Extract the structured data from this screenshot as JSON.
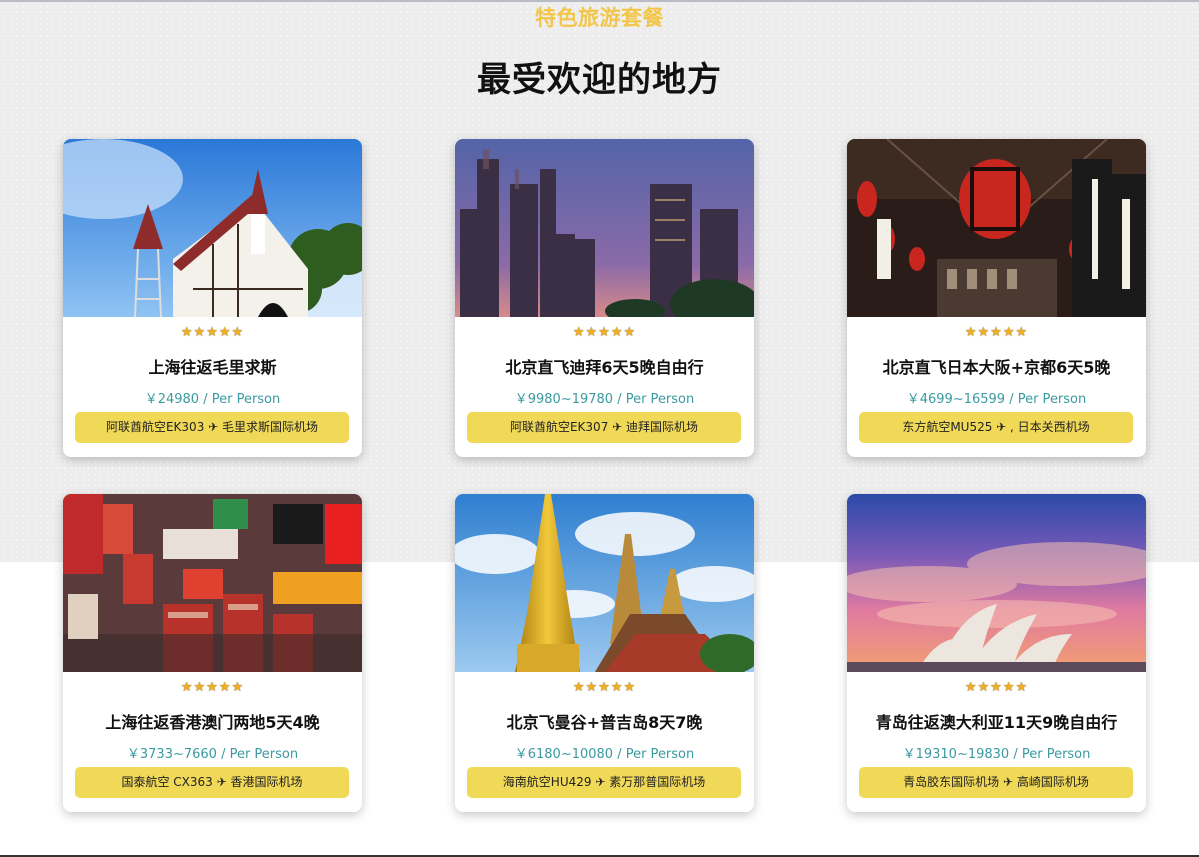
{
  "section": {
    "eyebrow": "特色旅游套餐",
    "headline": "最受欢迎的地方"
  },
  "cards": [
    {
      "image": "mauritius-church-photo",
      "rating": "★★★★★",
      "rating_value": 5,
      "title": "上海往返毛里求斯",
      "price": "￥24980 / Per Person",
      "flight": "阿联酋航空EK303 ✈ 毛里求斯国际机场"
    },
    {
      "image": "dubai-skyline-photo",
      "rating": "★★★★★",
      "rating_value": 5,
      "title": "北京直飞迪拜6天5晚自由行",
      "price": "￥9980~19780 / Per Person",
      "flight": "阿联酋航空EK307 ✈ 迪拜国际机场"
    },
    {
      "image": "osaka-street-lanterns-photo",
      "rating": "★★★★★",
      "rating_value": 5,
      "title": "北京直飞日本大阪+京都6天5晚",
      "price": "￥4699~16599 / Per Person",
      "flight": "东方航空MU525 ✈ , 日本关西机场"
    },
    {
      "image": "hongkong-street-signs-photo",
      "rating": "★★★★★",
      "rating_value": 5,
      "title": "上海往返香港澳门两地5天4晚",
      "price": "￥3733~7660 / Per Person",
      "flight": "国泰航空 CX363 ✈ 香港国际机场"
    },
    {
      "image": "bangkok-golden-temple-photo",
      "rating": "★★★★★",
      "rating_value": 5,
      "title": "北京飞曼谷+普吉岛8天7晚",
      "price": "￥6180~10080 / Per Person",
      "flight": "海南航空HU429 ✈ 素万那普国际机场"
    },
    {
      "image": "sydney-opera-house-sunset-photo",
      "rating": "★★★★★",
      "rating_value": 5,
      "title": "青岛往返澳大利亚11天9晚自由行",
      "price": "￥19310~19830 / Per Person",
      "flight": "青岛胶东国际机场 ✈ 高崎国际机场"
    }
  ],
  "colors": {
    "accent": "#f3c64a",
    "button": "#f1d958",
    "price": "#3a9aa0"
  }
}
